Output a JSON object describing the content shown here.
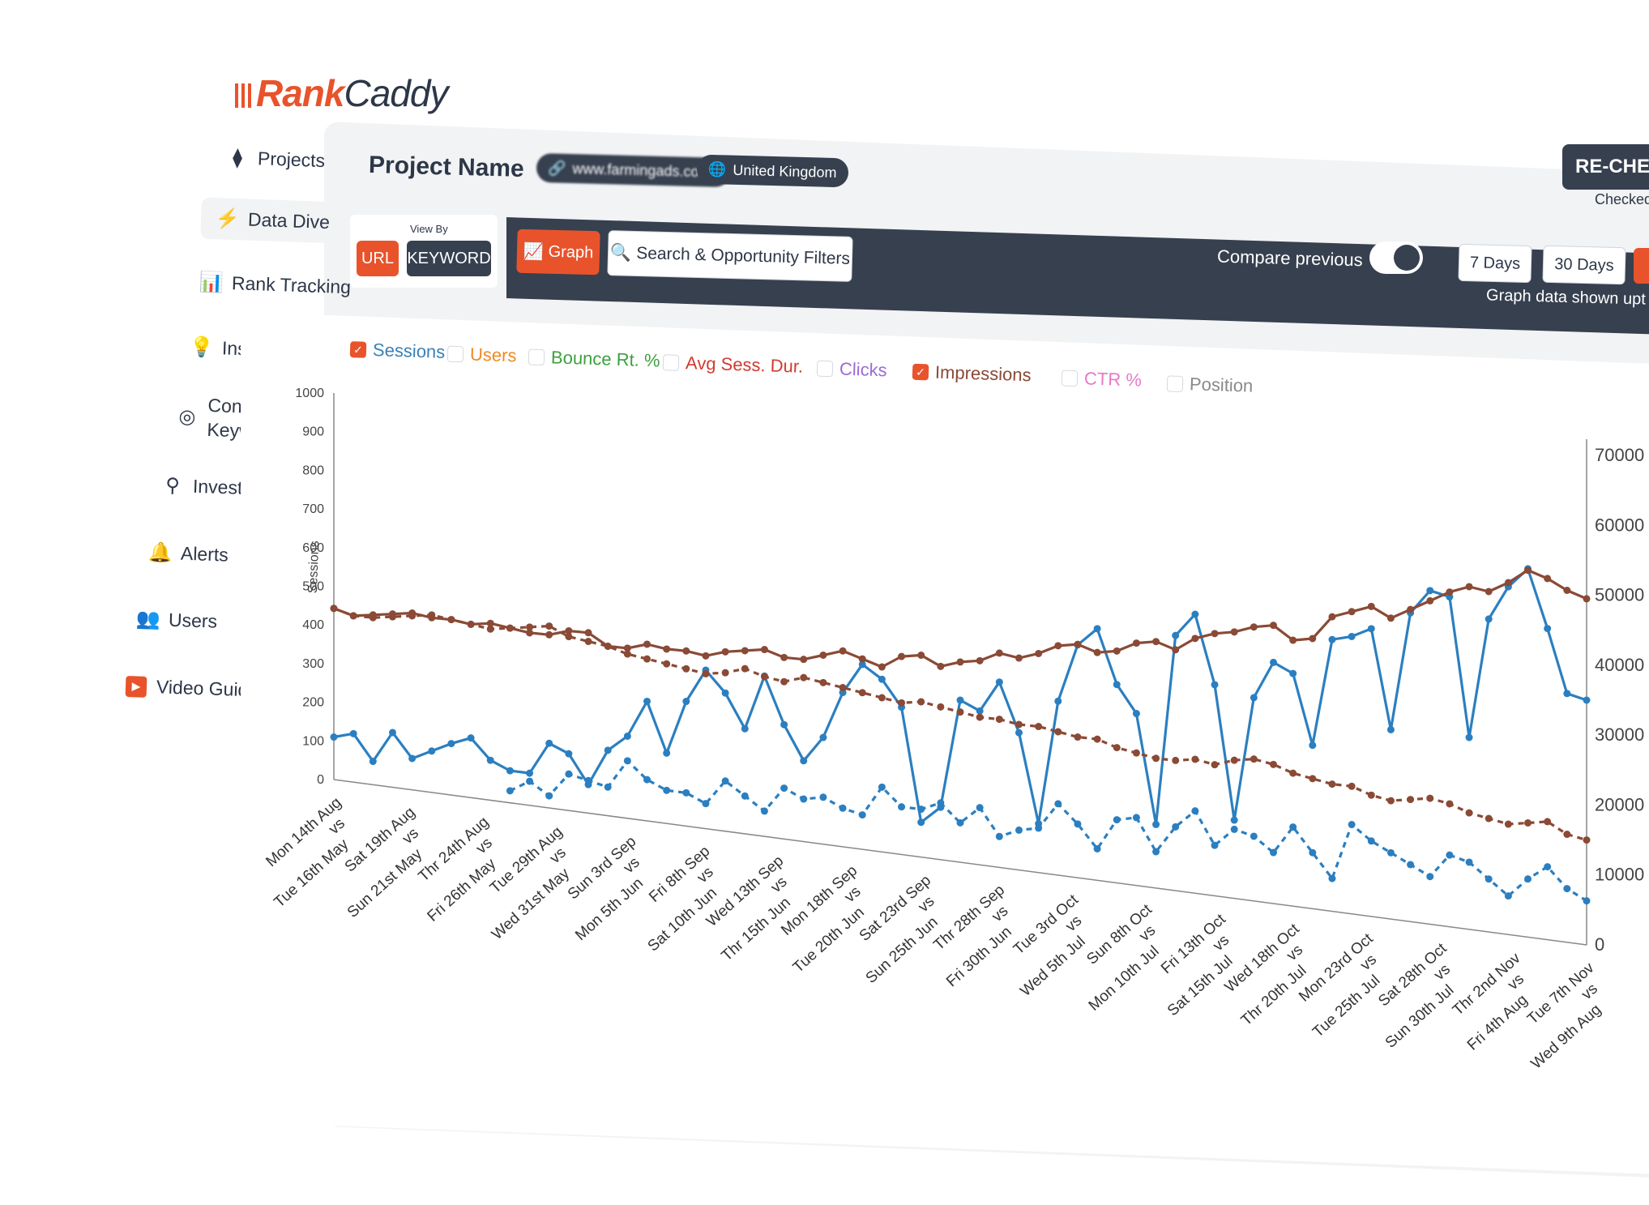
{
  "brand": {
    "rank": "Rank",
    "caddy": "Caddy"
  },
  "sidebar": {
    "items": [
      {
        "label": "Projects",
        "icon": "projects-icon"
      },
      {
        "label": "Data Dive",
        "icon": "lightning-icon"
      },
      {
        "label": "Rank Tracking",
        "icon": "bar-chart-icon"
      },
      {
        "label": "Insights",
        "icon": "lightbulb-icon"
      },
      {
        "label": "Content &",
        "label2": "Keywords",
        "icon": "target-icon"
      },
      {
        "label": "Investigate",
        "icon": "search-icon"
      },
      {
        "label": "Alerts",
        "icon": "bell-icon"
      },
      {
        "label": "Users",
        "icon": "users-icon"
      },
      {
        "label": "Video Guides",
        "icon": "video-icon"
      }
    ]
  },
  "header": {
    "project_name": "Project Name",
    "domain": "www.farmingads.co.uk",
    "country": "United Kingdom",
    "recheck_label": "RE-CHEC",
    "checked_label": "Checked"
  },
  "toolbar": {
    "view_by_label": "View By",
    "url_label": "URL",
    "keyword_label": "KEYWORD",
    "graph_label": "Graph",
    "filters_label": "Search & Opportunity Filters",
    "compare_label": "Compare previous",
    "compare_on": true,
    "range_7": "7 Days",
    "range_30": "30 Days",
    "graph_note": "Graph data shown upt"
  },
  "legend": [
    {
      "label": "Sessions",
      "checked": true,
      "color": "#3b82b6"
    },
    {
      "label": "Users",
      "checked": false,
      "color": "#f08a24"
    },
    {
      "label": "Bounce Rt. %",
      "checked": false,
      "color": "#3da13d"
    },
    {
      "label": "Avg Sess. Dur.",
      "checked": false,
      "color": "#d33a32"
    },
    {
      "label": "Clicks",
      "checked": false,
      "color": "#9b6dd6"
    },
    {
      "label": "Impressions",
      "checked": true,
      "color": "#8a4a36"
    },
    {
      "label": "CTR %",
      "checked": false,
      "color": "#e879c6"
    },
    {
      "label": "Position",
      "checked": false,
      "color": "#8a8a8a"
    }
  ],
  "chart_data": {
    "type": "line",
    "ylabel": "Sessions",
    "y_left": {
      "min": 0,
      "max": 1000,
      "ticks": [
        0,
        100,
        200,
        300,
        400,
        500,
        600,
        700,
        800,
        900,
        1000
      ]
    },
    "y_right": {
      "min": 0,
      "max": 70000,
      "ticks": [
        "0",
        "10000",
        "20000",
        "30000",
        "40000",
        "50000",
        "60000",
        "70000"
      ]
    },
    "x_labels": [
      [
        "Mon 14th Aug",
        "vs",
        "Tue 16th May"
      ],
      [
        "Sat 19th Aug",
        "vs",
        "Sun 21st May"
      ],
      [
        "Thr 24th Aug",
        "vs",
        "Fri 26th May"
      ],
      [
        "Tue 29th Aug",
        "vs",
        "Wed 31st May"
      ],
      [
        "Sun 3rd Sep",
        "vs",
        "Mon 5th Jun"
      ],
      [
        "Fri 8th Sep",
        "vs",
        "Sat 10th Jun"
      ],
      [
        "Wed 13th Sep",
        "vs",
        "Thr 15th Jun"
      ],
      [
        "Mon 18th Sep",
        "vs",
        "Tue 20th Jun"
      ],
      [
        "Sat 23rd Sep",
        "vs",
        "Sun 25th Jun"
      ],
      [
        "Thr 28th Sep",
        "vs",
        "Fri 30th Jun"
      ],
      [
        "Tue 3rd Oct",
        "vs",
        "Wed 5th Jul"
      ],
      [
        "Sun 8th Oct",
        "vs",
        "Mon 10th Jul"
      ],
      [
        "Fri 13th Oct",
        "vs",
        "Sat 15th Jul"
      ],
      [
        "Wed 18th Oct",
        "vs",
        "Thr 20th Jul"
      ],
      [
        "Mon 23rd Oct",
        "vs",
        "Tue 25th Jul"
      ],
      [
        "Sat 28th Oct",
        "vs",
        "Sun 30th Jul"
      ],
      [
        "Thr 2nd Nov",
        "vs",
        "Fri 4th Aug"
      ],
      [
        "Tue 7th Nov",
        "vs",
        "Wed 9th Aug"
      ]
    ],
    "series": [
      {
        "name": "Sessions",
        "axis": "left",
        "style": "solid",
        "color": "#2b7fc0",
        "values": [
          110,
          125,
          60,
          140,
          80,
          105,
          130,
          150,
          100,
          80,
          80,
          160,
          140,
          70,
          160,
          200,
          290,
          170,
          300,
          380,
          330,
          250,
          380,
          270,
          190,
          250,
          360,
          430,
          400,
          340,
          80,
          120,
          370,
          350,
          420,
          310,
          110,
          390,
          520,
          560,
          440,
          380,
          140,
          560,
          610,
          460,
          170,
          440,
          520,
          500,
          350,
          580,
          590,
          610,
          400,
          650,
          700,
          690,
          400,
          650,
          720,
          760,
          640,
          510,
          500
        ]
      },
      {
        "name": "Sessions (previous)",
        "axis": "left",
        "style": "dashed",
        "color": "#2b7fc0",
        "values": [
          null,
          null,
          null,
          null,
          null,
          null,
          null,
          null,
          null,
          30,
          60,
          30,
          90,
          80,
          70,
          140,
          100,
          80,
          80,
          60,
          120,
          90,
          60,
          120,
          100,
          110,
          90,
          80,
          150,
          110,
          110,
          130,
          90,
          130,
          70,
          90,
          100,
          160,
          120,
          70,
          140,
          150,
          80,
          140,
          180,
          110,
          150,
          140,
          110,
          170,
          120,
          70,
          190,
          160,
          140,
          120,
          100,
          150,
          140,
          110,
          80,
          120,
          150,
          110,
          90
        ]
      },
      {
        "name": "Impressions",
        "axis": "right",
        "style": "solid",
        "color": "#8a4a36",
        "values": [
          31000,
          30000,
          30500,
          31000,
          31500,
          31000,
          31000,
          30500,
          31000,
          30500,
          30000,
          30000,
          31000,
          31000,
          29000,
          29000,
          30000,
          29500,
          29500,
          29000,
          30000,
          30500,
          31000,
          30000,
          30000,
          31000,
          32000,
          31000,
          30000,
          32000,
          32500,
          31000,
          32000,
          32500,
          34000,
          33500,
          34500,
          36000,
          36500,
          35500,
          36000,
          37500,
          38000,
          37000,
          39000,
          40000,
          40500,
          41500,
          42000,
          40000,
          40500,
          44000,
          45000,
          46000,
          44500,
          46000,
          47500,
          49000,
          50000,
          49500,
          51000,
          53000,
          52000,
          50500,
          49500
        ]
      },
      {
        "name": "Impressions (previous)",
        "axis": "right",
        "style": "dashed",
        "color": "#8a4a36",
        "values": [
          31000,
          30000,
          30000,
          30500,
          31000,
          31500,
          31000,
          30500,
          30000,
          30500,
          31000,
          31500,
          30000,
          29500,
          29000,
          28000,
          27500,
          27000,
          26500,
          26000,
          26500,
          27500,
          26500,
          26000,
          27000,
          26500,
          26000,
          25500,
          25000,
          24500,
          25000,
          24500,
          24000,
          23500,
          23500,
          23000,
          23000,
          22500,
          22000,
          22000,
          21000,
          20500,
          20000,
          20000,
          20500,
          20000,
          21000,
          21500,
          21000,
          20000,
          19500,
          19000,
          19000,
          18000,
          17500,
          18000,
          18500,
          18000,
          17000,
          16500,
          16000,
          16500,
          17000,
          15500,
          15000
        ]
      }
    ]
  }
}
